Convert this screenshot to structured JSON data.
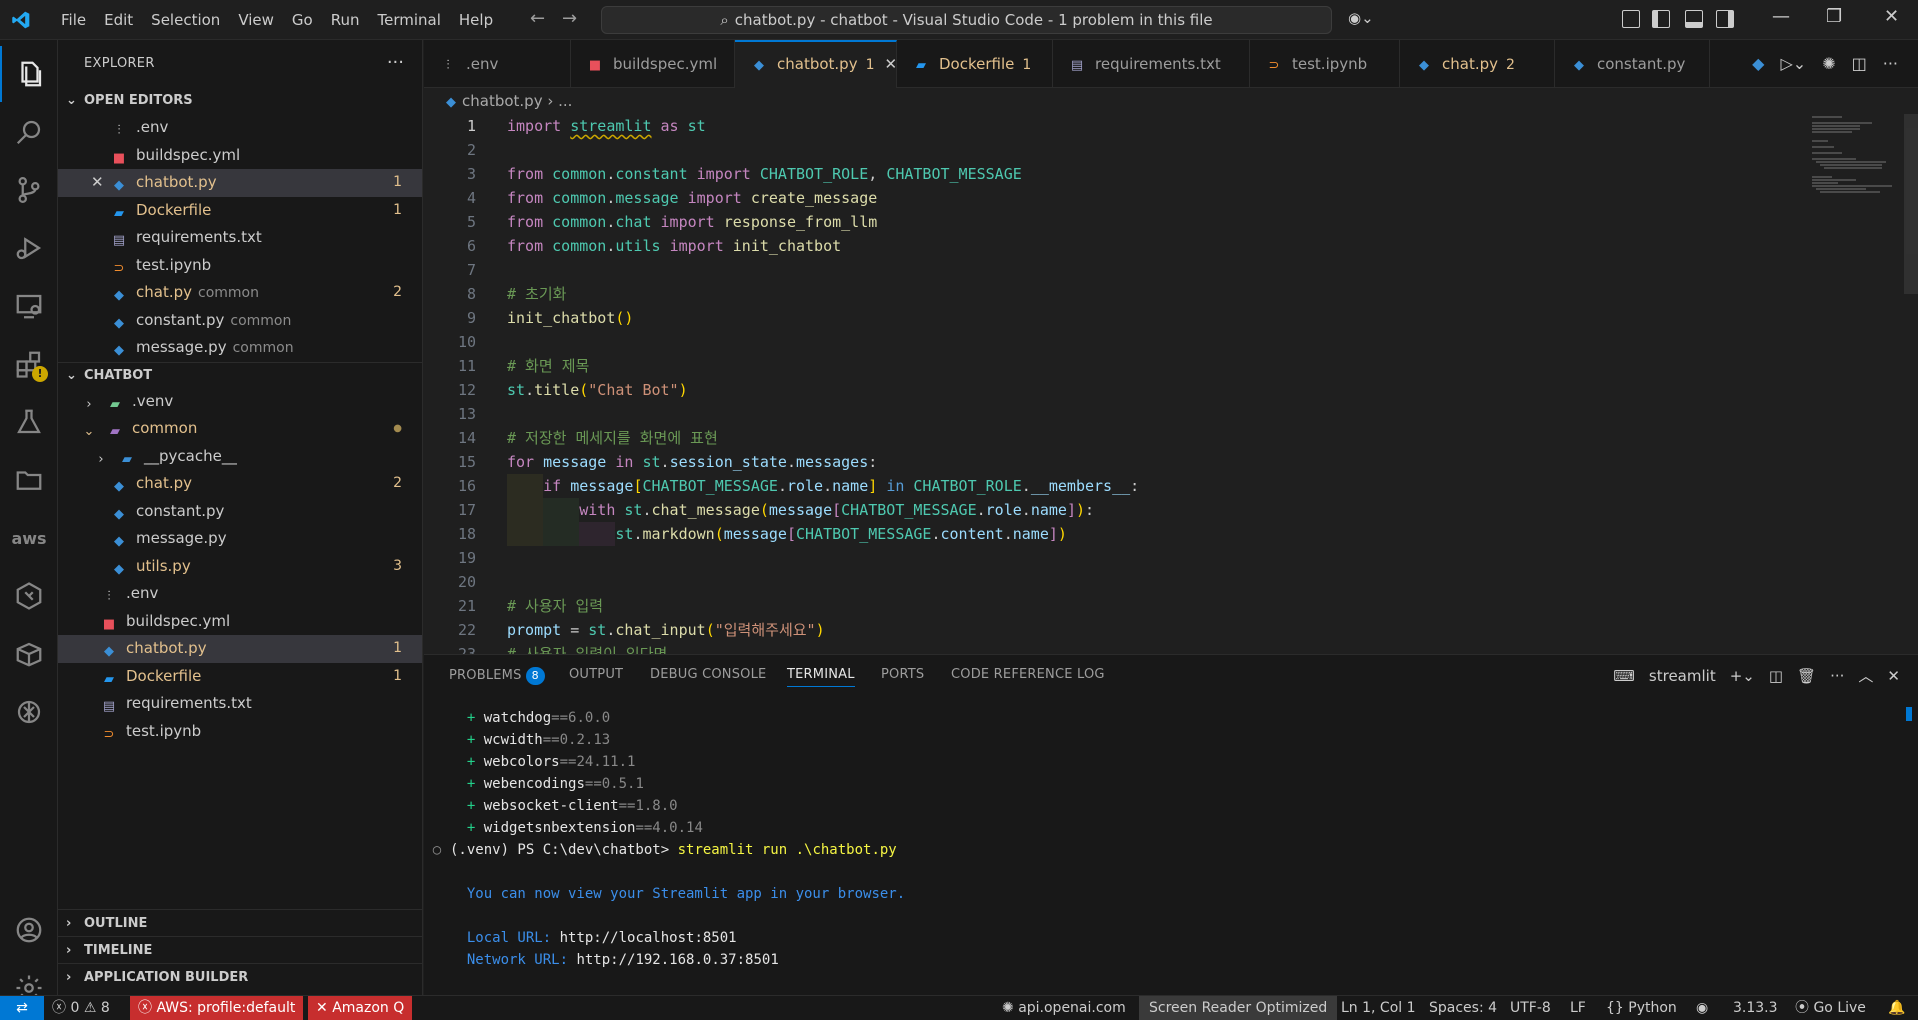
{
  "window": {
    "title": "chatbot.py - chatbot - Visual Studio Code - 1 problem in this file"
  },
  "menu": [
    "File",
    "Edit",
    "Selection",
    "View",
    "Go",
    "Run",
    "Terminal",
    "Help"
  ],
  "sidebar": {
    "title": "EXPLORER",
    "open_editors_label": "OPEN EDITORS",
    "open_editors": [
      {
        "name": ".env",
        "icon": "env-icon",
        "desc": "",
        "badge": ""
      },
      {
        "name": "buildspec.yml",
        "icon": "yaml-icon",
        "desc": "",
        "badge": ""
      },
      {
        "name": "chatbot.py",
        "icon": "python-icon",
        "desc": "",
        "badge": "1"
      },
      {
        "name": "Dockerfile",
        "icon": "docker-icon",
        "desc": "",
        "badge": "1"
      },
      {
        "name": "requirements.txt",
        "icon": "text-file-icon",
        "desc": "",
        "badge": ""
      },
      {
        "name": "test.ipynb",
        "icon": "notebook-icon",
        "desc": "",
        "badge": ""
      },
      {
        "name": "chat.py",
        "icon": "python-icon",
        "desc": "common",
        "badge": "2"
      },
      {
        "name": "constant.py",
        "icon": "python-icon",
        "desc": "common",
        "badge": ""
      },
      {
        "name": "message.py",
        "icon": "python-icon",
        "desc": "common",
        "badge": ""
      }
    ],
    "workspace_label": "CHATBOT",
    "tree": [
      {
        "name": ".venv",
        "badge": ""
      },
      {
        "name": "common",
        "badge": "●"
      },
      {
        "name": "__pycache__",
        "badge": ""
      },
      {
        "name": "chat.py",
        "badge": "2"
      },
      {
        "name": "constant.py",
        "badge": ""
      },
      {
        "name": "message.py",
        "badge": ""
      },
      {
        "name": "utils.py",
        "badge": "3"
      },
      {
        "name": ".env",
        "badge": ""
      },
      {
        "name": "buildspec.yml",
        "badge": ""
      },
      {
        "name": "chatbot.py",
        "badge": "1"
      },
      {
        "name": "Dockerfile",
        "badge": "1"
      },
      {
        "name": "requirements.txt",
        "badge": ""
      },
      {
        "name": "test.ipynb",
        "badge": ""
      }
    ],
    "outline_label": "OUTLINE",
    "timeline_label": "TIMELINE",
    "app_builder_label": "APPLICATION BUILDER"
  },
  "tabs": [
    {
      "name": ".env",
      "count": ""
    },
    {
      "name": "buildspec.yml",
      "count": ""
    },
    {
      "name": "chatbot.py",
      "count": "1"
    },
    {
      "name": "Dockerfile",
      "count": "1"
    },
    {
      "name": "requirements.txt",
      "count": ""
    },
    {
      "name": "test.ipynb",
      "count": ""
    },
    {
      "name": "chat.py",
      "count": "2"
    },
    {
      "name": "constant.py",
      "count": ""
    }
  ],
  "breadcrumb": {
    "file": "chatbot.py",
    "rest": "..."
  },
  "editor": {
    "line_numbers": [
      "1",
      "2",
      "3",
      "4",
      "5",
      "6",
      "7",
      "8",
      "9",
      "10",
      "11",
      "12",
      "13",
      "14",
      "15",
      "16",
      "17",
      "18",
      "19",
      "20",
      "21",
      "22",
      "23"
    ],
    "lines": [
      "import streamlit as st",
      "",
      "from common.constant import CHATBOT_ROLE, CHATBOT_MESSAGE",
      "from common.message import create_message",
      "from common.chat import response_from_llm",
      "from common.utils import init_chatbot",
      "",
      "# 초기화",
      "init_chatbot()",
      "",
      "# 화면 제목",
      "st.title(\"Chat Bot\")",
      "",
      "# 저장한 메세지를 화면에 표현",
      "for message in st.session_state.messages:",
      "    if message[CHATBOT_MESSAGE.role.name] in CHATBOT_ROLE.__members__:",
      "        with st.chat_message(message[CHATBOT_MESSAGE.role.name]):",
      "            st.markdown(message[CHATBOT_MESSAGE.content.name])",
      "",
      "",
      "# 사용자 입력",
      "prompt = st.chat_input(\"입력해주세요\")",
      "# 사용자 입력이 있다면,"
    ]
  },
  "panel": {
    "tabs": {
      "problems": "PROBLEMS",
      "problems_count": "8",
      "output": "OUTPUT",
      "debug_console": "DEBUG CONSOLE",
      "terminal": "TERMINAL",
      "ports": "PORTS",
      "code_reference_log": "CODE REFERENCE LOG"
    },
    "terminal_name": "streamlit",
    "packages": [
      {
        "name": "watchdog",
        "version": "==6.0.0"
      },
      {
        "name": "wcwidth",
        "version": "==0.2.13"
      },
      {
        "name": "webcolors",
        "version": "==24.11.1"
      },
      {
        "name": "webencodings",
        "version": "==0.5.1"
      },
      {
        "name": "websocket-client",
        "version": "==1.8.0"
      },
      {
        "name": "widgetsnbextension",
        "version": "==4.0.14"
      }
    ],
    "prompt": "(.venv) PS C:\\dev\\chatbot>",
    "command": "streamlit run .\\chatbot.py",
    "view_msg": "You can now view your Streamlit app in your browser.",
    "local_label": "Local URL:",
    "local_url": "http://localhost:8501",
    "network_label": "Network URL:",
    "network_url": "http://192.168.0.37:8501"
  },
  "statusbar": {
    "errors": "0",
    "warnings": "8",
    "aws_profile": "AWS: profile:default",
    "amazon_q": "Amazon Q",
    "api": "api.openai.com",
    "screen_reader": "Screen Reader Optimized",
    "position": "Ln 1, Col 1",
    "spaces": "Spaces: 4",
    "encoding": "UTF-8",
    "eol": "LF",
    "language": "Python",
    "python_version": "3.13.3",
    "go_live": "Go Live"
  },
  "colors": {
    "accent": "#0078d4",
    "modified": "#e2c08d",
    "error_red": "#c72e2e"
  }
}
